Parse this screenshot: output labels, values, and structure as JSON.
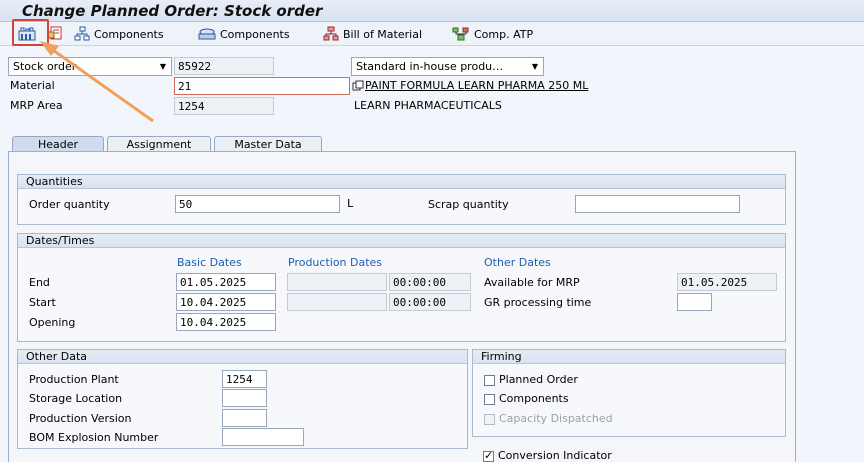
{
  "window": {
    "title": "Change Planned Order: Stock order"
  },
  "toolbar": {
    "components_tree": "Components",
    "components_list": "Components",
    "bill_of_material": "Bill of Material",
    "comp_atp": "Comp. ATP"
  },
  "head": {
    "order_type": "Stock order",
    "order_number": "85922",
    "procurement": "Standard in-house produ…",
    "material_label": "Material",
    "material_value": "21",
    "material_desc": "PAINT FORMULA LEARN PHARMA 250 ML",
    "mrp_area_label": "MRP Area",
    "mrp_area_value": "1254",
    "mrp_area_desc": "LEARN PHARMACEUTICALS"
  },
  "tabs": [
    "Header",
    "Assignment",
    "Master Data"
  ],
  "quantities": {
    "title": "Quantities",
    "order_qty_label": "Order quantity",
    "order_qty": "50",
    "unit": "L",
    "scrap_label": "Scrap quantity",
    "scrap_value": ""
  },
  "dates": {
    "title": "Dates/Times",
    "basic_dates": "Basic Dates",
    "production_dates": "Production Dates",
    "other_dates": "Other Dates",
    "end_label": "End",
    "end_date": "01.05.2025",
    "end_time": "00:00:00",
    "start_label": "Start",
    "start_date": "10.04.2025",
    "start_time": "00:00:00",
    "opening_label": "Opening",
    "opening_date": "10.04.2025",
    "available_label": "Available for MRP",
    "available_date": "01.05.2025",
    "gr_label": "GR processing time",
    "gr_value": ""
  },
  "other_data": {
    "title": "Other Data",
    "plant_label": "Production Plant",
    "plant": "1254",
    "storage_label": "Storage Location",
    "version_label": "Production Version",
    "bom_label": "BOM Explosion Number"
  },
  "firming": {
    "title": "Firming",
    "planned_order": "Planned Order",
    "components": "Components",
    "capacity": "Capacity Dispatched",
    "conversion": "Conversion Indicator"
  }
}
